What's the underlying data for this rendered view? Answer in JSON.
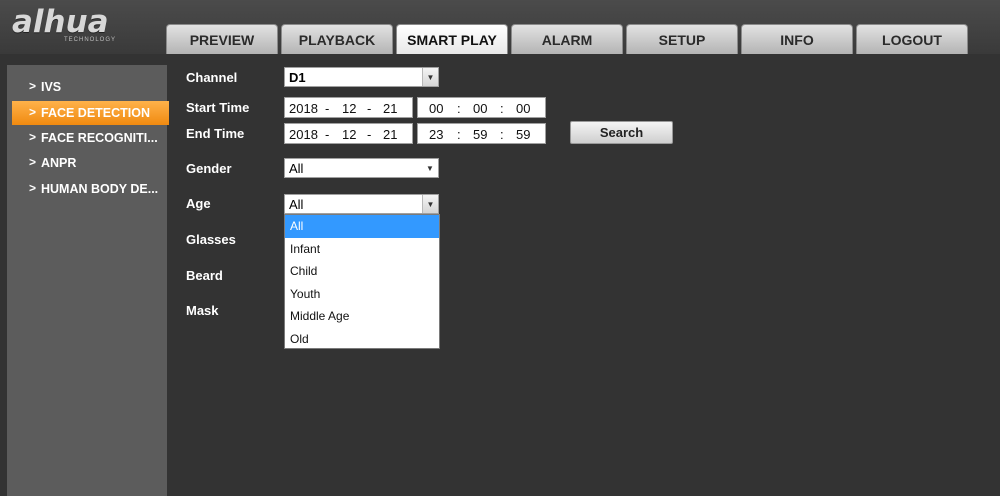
{
  "logo": {
    "main": "alhua",
    "sub": "TECHNOLOGY"
  },
  "nav": {
    "tabs": [
      {
        "label": "PREVIEW"
      },
      {
        "label": "PLAYBACK"
      },
      {
        "label": "SMART PLAY"
      },
      {
        "label": "ALARM"
      },
      {
        "label": "SETUP"
      },
      {
        "label": "INFO"
      },
      {
        "label": "LOGOUT"
      }
    ],
    "active_tab": "SMART PLAY"
  },
  "sidebar": {
    "chevron": ">",
    "items": [
      {
        "label": "IVS"
      },
      {
        "label": "FACE DETECTION"
      },
      {
        "label": "FACE RECOGNITI..."
      },
      {
        "label": "ANPR"
      },
      {
        "label": "HUMAN BODY DE..."
      }
    ],
    "active_item": "FACE DETECTION"
  },
  "form": {
    "channel": {
      "label": "Channel",
      "value": "D1"
    },
    "start_time": {
      "label": "Start Time",
      "year": "2018",
      "month": "12",
      "day": "21",
      "hour": "00",
      "minute": "00",
      "second": "00"
    },
    "end_time": {
      "label": "End Time",
      "year": "2018",
      "month": "12",
      "day": "21",
      "hour": "23",
      "minute": "59",
      "second": "59"
    },
    "date_sep": "-",
    "time_sep": ":",
    "search_label": "Search",
    "gender": {
      "label": "Gender",
      "value": "All"
    },
    "age": {
      "label": "Age",
      "value": "All",
      "options": [
        "All",
        "Infant",
        "Child",
        "Youth",
        "Middle Age",
        "Old"
      ],
      "highlighted": "All"
    },
    "glasses": {
      "label": "Glasses"
    },
    "beard": {
      "label": "Beard"
    },
    "mask": {
      "label": "Mask"
    }
  },
  "colors": {
    "active_tab": "#ffffff",
    "active_sidebar": "#f39a1c",
    "dropdown_highlight": "#3399ff",
    "background": "#333333",
    "sidebar_bg": "#5c5c5c"
  }
}
